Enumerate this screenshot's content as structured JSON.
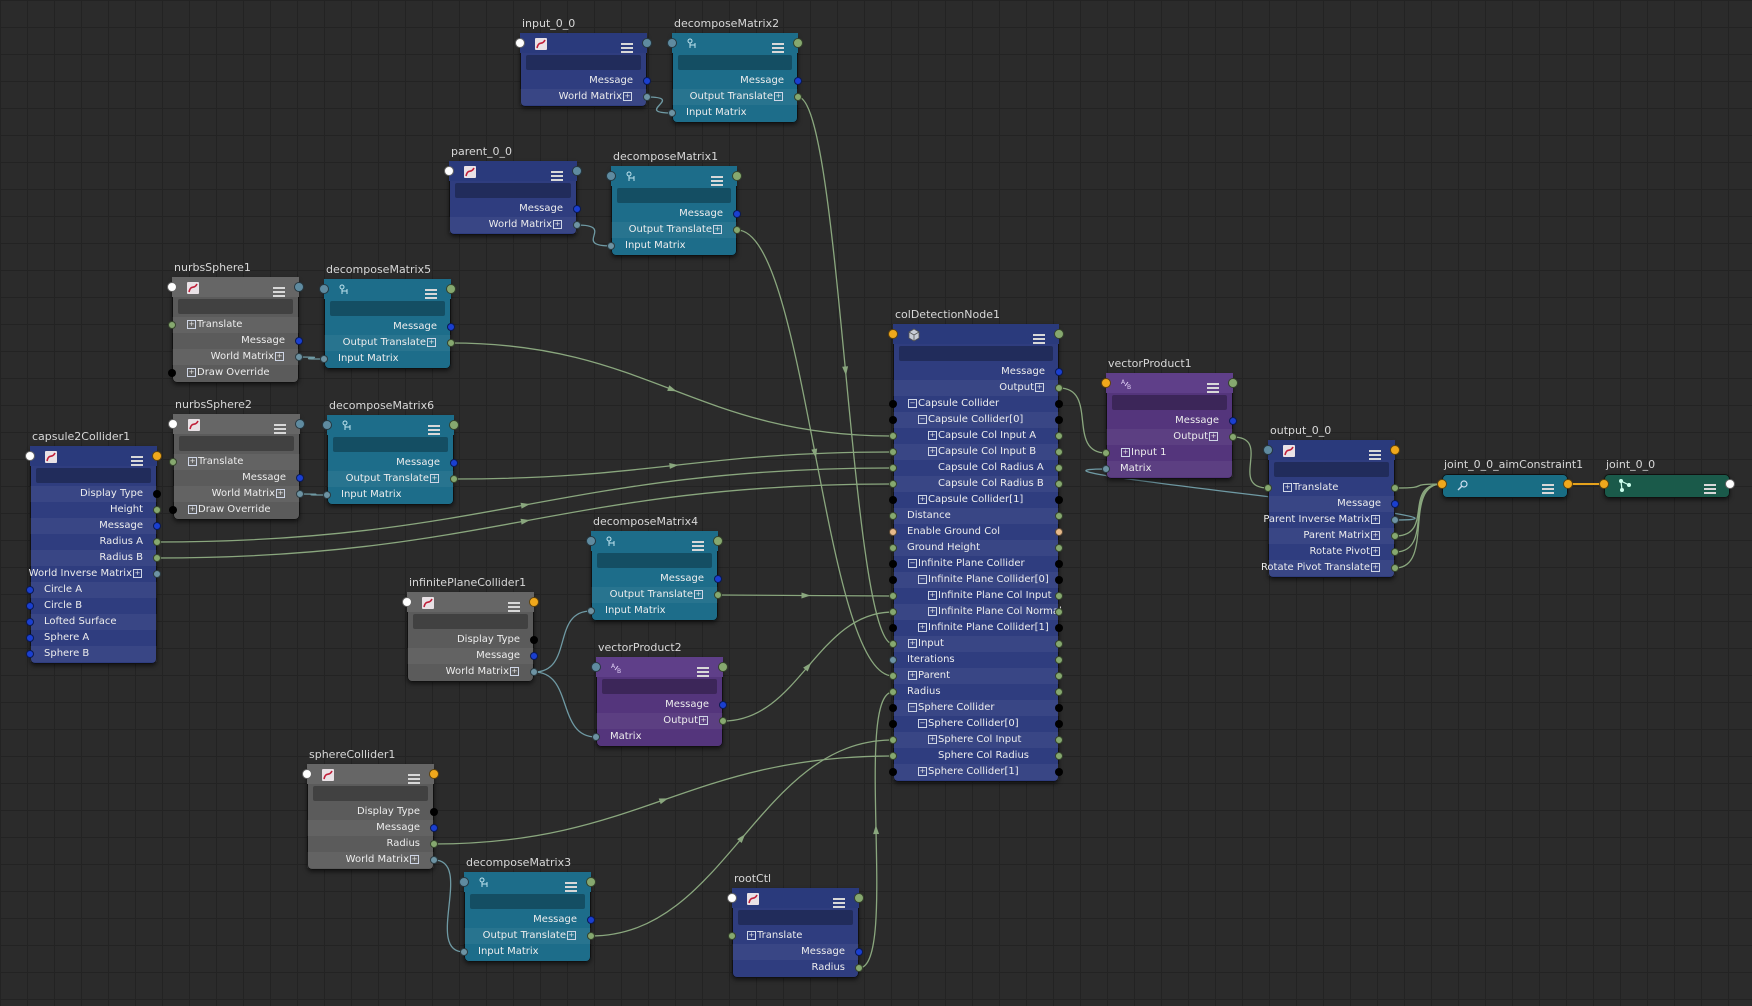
{
  "editor": "node-graph",
  "nodes": {
    "input_0_0": {
      "title": "input_0_0",
      "attrs": [
        "Message",
        "World Matrix"
      ]
    },
    "decomposeMatrix2": {
      "title": "decomposeMatrix2",
      "attrs": [
        "Message",
        "Output Translate",
        "Input Matrix"
      ]
    },
    "parent_0_0": {
      "title": "parent_0_0",
      "attrs": [
        "Message",
        "World Matrix"
      ]
    },
    "decomposeMatrix1": {
      "title": "decomposeMatrix1",
      "attrs": [
        "Message",
        "Output Translate",
        "Input Matrix"
      ]
    },
    "nurbsSphere1": {
      "title": "nurbsSphere1",
      "attrs": [
        "Translate",
        "Message",
        "World Matrix",
        "Draw Override"
      ]
    },
    "decomposeMatrix5": {
      "title": "decomposeMatrix5",
      "attrs": [
        "Message",
        "Output Translate",
        "Input Matrix"
      ]
    },
    "nurbsSphere2": {
      "title": "nurbsSphere2",
      "attrs": [
        "Translate",
        "Message",
        "World Matrix",
        "Draw Override"
      ]
    },
    "decomposeMatrix6": {
      "title": "decomposeMatrix6",
      "attrs": [
        "Message",
        "Output Translate",
        "Input Matrix"
      ]
    },
    "capsule2Collider1": {
      "title": "capsule2Collider1",
      "attrs": [
        "Display Type",
        "Height",
        "Message",
        "Radius A",
        "Radius B",
        "World Inverse Matrix",
        "Circle A",
        "Circle B",
        "Lofted Surface",
        "Sphere A",
        "Sphere B"
      ]
    },
    "decomposeMatrix4": {
      "title": "decomposeMatrix4",
      "attrs": [
        "Message",
        "Output Translate",
        "Input Matrix"
      ]
    },
    "infinitePlaneCollider1": {
      "title": "infinitePlaneCollider1",
      "attrs": [
        "Display Type",
        "Message",
        "World Matrix"
      ]
    },
    "vectorProduct2": {
      "title": "vectorProduct2",
      "attrs": [
        "Message",
        "Output",
        "Matrix"
      ]
    },
    "sphereCollider1": {
      "title": "sphereCollider1",
      "attrs": [
        "Display Type",
        "Message",
        "Radius",
        "World Matrix"
      ]
    },
    "decomposeMatrix3": {
      "title": "decomposeMatrix3",
      "attrs": [
        "Message",
        "Output Translate",
        "Input Matrix"
      ]
    },
    "rootCtl": {
      "title": "rootCtl",
      "attrs": [
        "Translate",
        "Message",
        "Radius"
      ]
    },
    "colDetectionNode1": {
      "title": "colDetectionNode1",
      "attrs": [
        "Message",
        "Output",
        "Capsule Collider",
        "Capsule Collider[0]",
        "Capsule Col Input A",
        "Capsule Col Input B",
        "Capsule Col Radius A",
        "Capsule Col Radius B",
        "Capsule Collider[1]",
        "Distance",
        "Enable Ground Col",
        "Ground Height",
        "Infinite Plane Collider",
        "Infinite Plane Collider[0]",
        "Infinite Plane Col Input",
        "Infinite Plane Col Normal",
        "Infinite Plane Collider[1]",
        "Input",
        "Iterations",
        "Parent",
        "Radius",
        "Sphere Collider",
        "Sphere Collider[0]",
        "Sphere Col Input",
        "Sphere Col Radius",
        "Sphere Collider[1]"
      ]
    },
    "vectorProduct1": {
      "title": "vectorProduct1",
      "attrs": [
        "Message",
        "Output",
        "Input 1",
        "Matrix"
      ]
    },
    "output_0_0": {
      "title": "output_0_0",
      "attrs": [
        "Translate",
        "Message",
        "Parent Inverse Matrix",
        "Parent Matrix",
        "Rotate Pivot",
        "Rotate Pivot Translate"
      ]
    },
    "joint_0_0_aimConstraint1": {
      "title": "joint_0_0_aimConstraint1",
      "attrs": []
    },
    "joint_0_0": {
      "title": "joint_0_0",
      "attrs": []
    }
  },
  "colors": {
    "transform": "#2f3d7f",
    "decompose": "#1d6d8a",
    "collider": "#5b5b5b",
    "vectorProduct": "#54357c",
    "constraint": "#196d84",
    "joint": "#1a5a4a",
    "wire": "#8aa77e",
    "grid": "#2b2b2b"
  },
  "icons": {
    "transform": "curve-transform-icon",
    "decompose": "decompose-matrix-icon",
    "vectorProduct": "vector-product-icon",
    "colDetection": "cube-icon",
    "constraint": "aim-constraint-icon",
    "joint": "joint-icon",
    "menu": "menu-lines-icon"
  }
}
